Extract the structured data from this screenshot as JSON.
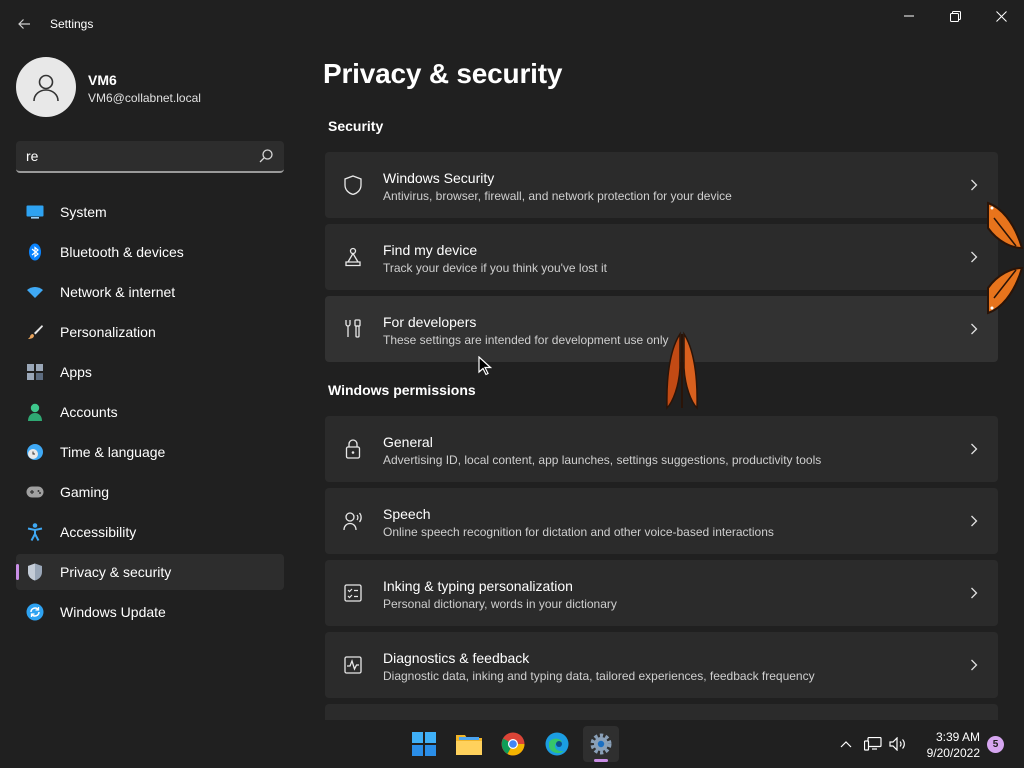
{
  "window": {
    "title": "Settings",
    "controls": [
      "minimize",
      "restore",
      "close"
    ]
  },
  "account": {
    "name": "VM6",
    "email": "VM6@collabnet.local"
  },
  "search": {
    "value": "re",
    "icon": "search-icon"
  },
  "nav": {
    "items": [
      {
        "label": "System",
        "icon": "monitor-icon",
        "color": "#2ea3f2"
      },
      {
        "label": "Bluetooth & devices",
        "icon": "bluetooth-icon",
        "color": "#0a84ff"
      },
      {
        "label": "Network & internet",
        "icon": "wifi-icon",
        "color": "#3fa9f5"
      },
      {
        "label": "Personalization",
        "icon": "brush-icon",
        "color": "#e8a35c"
      },
      {
        "label": "Apps",
        "icon": "apps-icon",
        "color": "#9aa7b8"
      },
      {
        "label": "Accounts",
        "icon": "person-icon",
        "color": "#3ec78c"
      },
      {
        "label": "Time & language",
        "icon": "globe-clock-icon",
        "color": "#3fa9f5"
      },
      {
        "label": "Gaming",
        "icon": "gamepad-icon",
        "color": "#a0a0a0"
      },
      {
        "label": "Accessibility",
        "icon": "accessibility-icon",
        "color": "#3fa9f5"
      },
      {
        "label": "Privacy & security",
        "icon": "shield-icon",
        "color": "#9aa7b8",
        "selected": true
      },
      {
        "label": "Windows Update",
        "icon": "update-icon",
        "color": "#2ea3f2"
      }
    ]
  },
  "main": {
    "title": "Privacy & security",
    "sections": [
      {
        "heading": "Security",
        "cards": [
          {
            "title": "Windows Security",
            "subtitle": "Antivirus, browser, firewall, and network protection for your device",
            "icon": "shield-icon"
          },
          {
            "title": "Find my device",
            "subtitle": "Track your device if you think you've lost it",
            "icon": "find-device-icon"
          },
          {
            "title": "For developers",
            "subtitle": "These settings are intended for development use only",
            "icon": "developer-tools-icon"
          }
        ]
      },
      {
        "heading": "Windows permissions",
        "cards": [
          {
            "title": "General",
            "subtitle": "Advertising ID, local content, app launches, settings suggestions, productivity tools",
            "icon": "lock-icon"
          },
          {
            "title": "Speech",
            "subtitle": "Online speech recognition for dictation and other voice-based interactions",
            "icon": "speech-icon"
          },
          {
            "title": "Inking & typing personalization",
            "subtitle": "Personal dictionary, words in your dictionary",
            "icon": "inking-icon"
          },
          {
            "title": "Diagnostics & feedback",
            "subtitle": "Diagnostic data, inking and typing data, tailored experiences, feedback frequency",
            "icon": "diagnostics-icon"
          }
        ]
      }
    ]
  },
  "taskbar": {
    "apps": [
      "start-icon",
      "file-explorer-icon",
      "chrome-icon",
      "edge-icon",
      "settings-icon"
    ],
    "active_app": "settings-icon",
    "tray": [
      "chevron-up-icon",
      "network-icon",
      "volume-icon"
    ],
    "time": "3:39 AM",
    "date": "9/20/2022",
    "notifications": "5"
  },
  "colors": {
    "background": "#202020",
    "card": "#2b2b2b",
    "accent": "#c98ee6"
  }
}
